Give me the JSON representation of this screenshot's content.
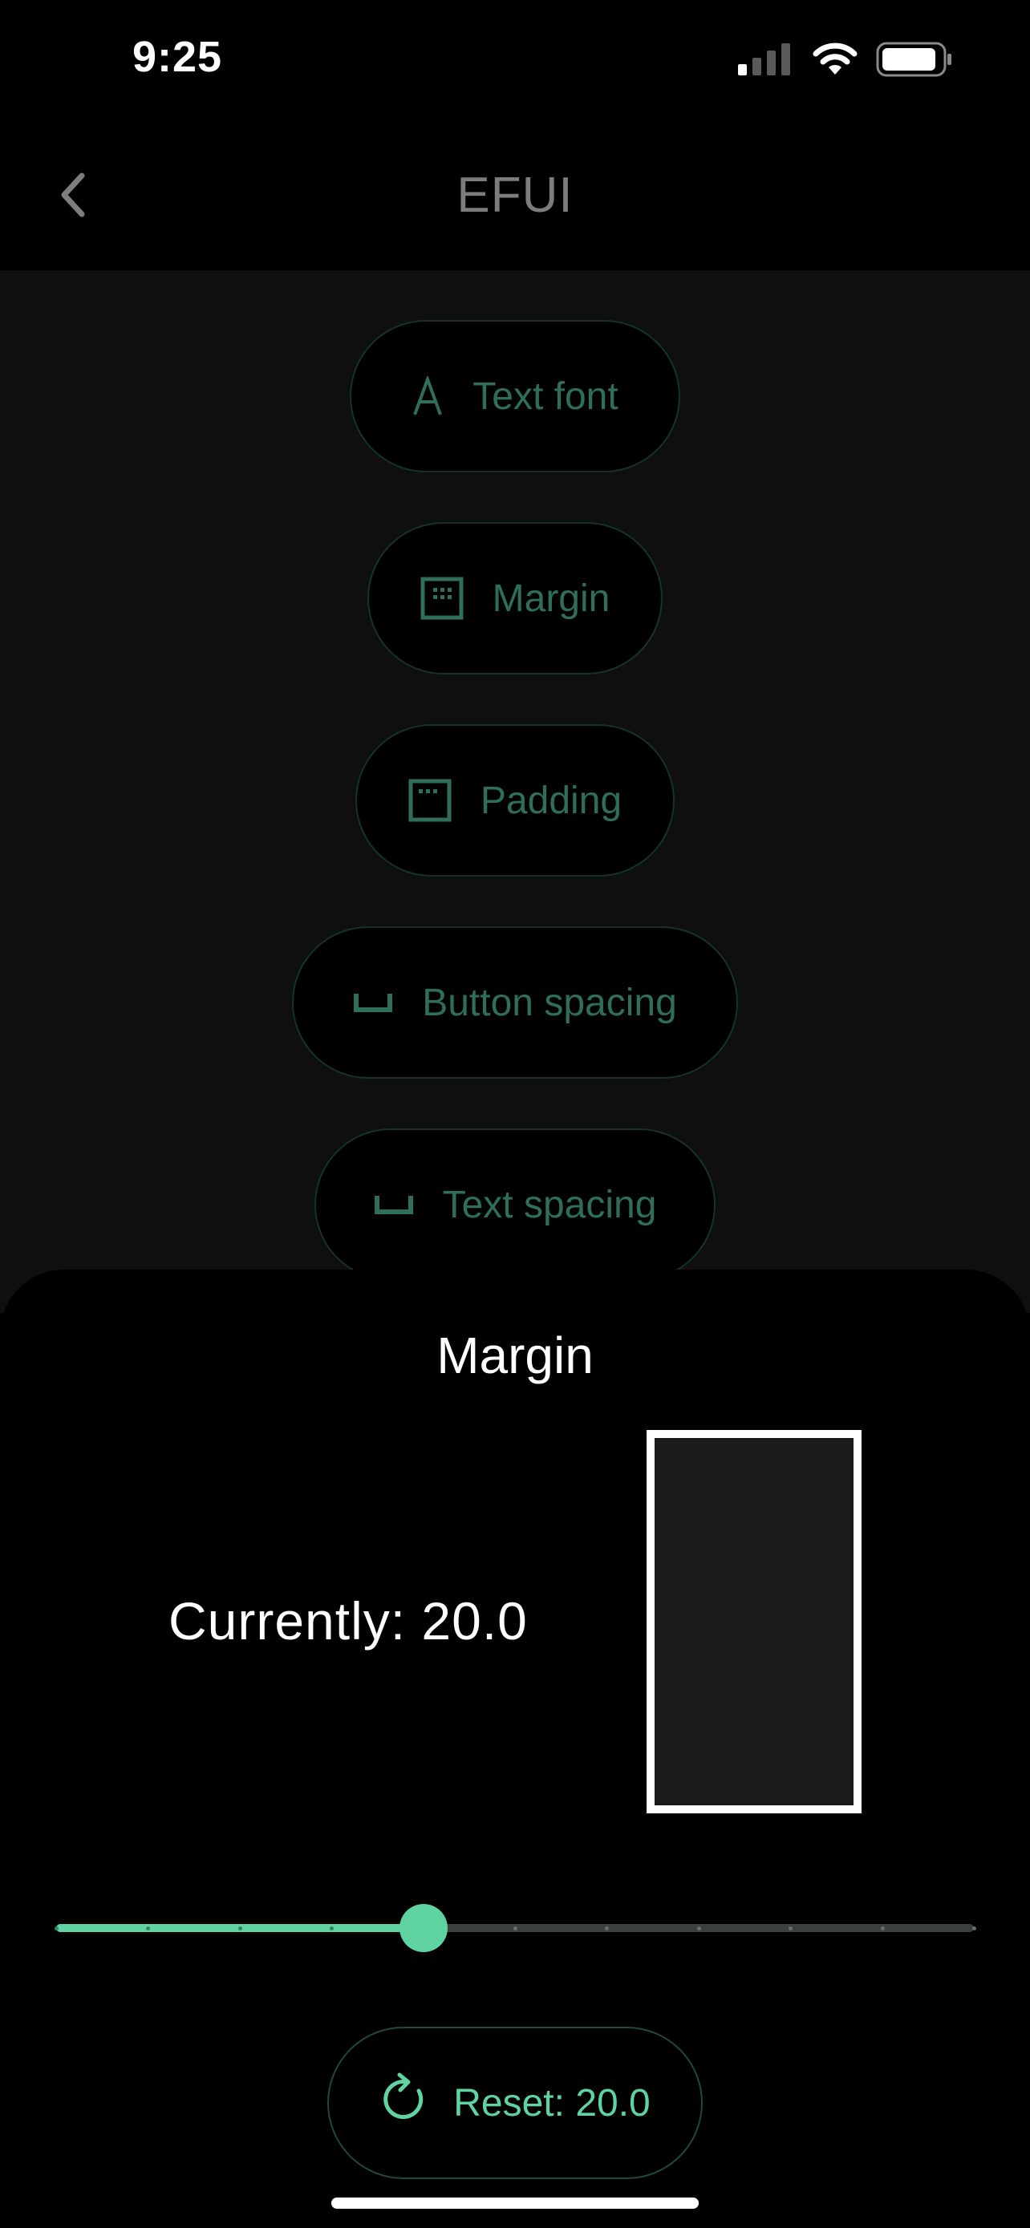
{
  "status_bar": {
    "time": "9:25"
  },
  "nav": {
    "title": "EFUI"
  },
  "options": [
    {
      "label": "Text font",
      "icon": "letter-a-icon"
    },
    {
      "label": "Margin",
      "icon": "margin-grid-icon"
    },
    {
      "label": "Padding",
      "icon": "padding-box-icon"
    },
    {
      "label": "Button spacing",
      "icon": "space-bracket-icon"
    },
    {
      "label": "Text spacing",
      "icon": "space-bracket-icon"
    }
  ],
  "sheet": {
    "title": "Margin",
    "current_label": "Currently: 20.0",
    "slider": {
      "value_fraction": 0.4,
      "ticks": 11
    },
    "reset_label": "Reset: 20.0"
  },
  "colors": {
    "accent": "#5fd3a1",
    "dim_text": "#2f6e58",
    "pill_border": "#14332a",
    "background_dimmed": "#0f0f0f"
  }
}
